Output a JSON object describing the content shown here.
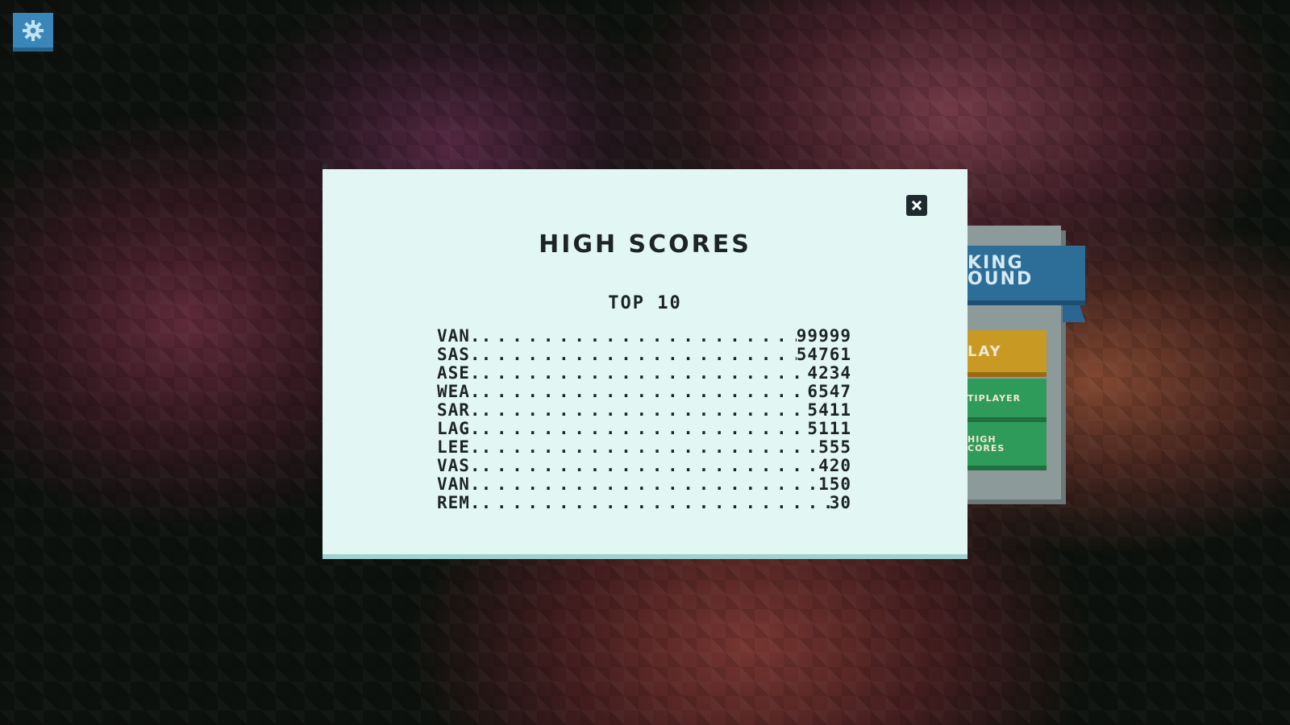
{
  "colors": {
    "dialog_bg": "#e2f7f4",
    "text": "#1e2426",
    "settings_button": "#3a86b8",
    "play_button": "#c99a23",
    "green_button": "#2f9b5a",
    "logo_blue": "#2d6e99"
  },
  "settings": {
    "icon": "gear-icon"
  },
  "main_menu": {
    "logo_line1": "KING",
    "logo_line2": "OUND",
    "play_label": "LAY",
    "multiplayer_label": "TIPLAYER",
    "high_scores_line1": "HIGH",
    "high_scores_line2": "CORES"
  },
  "dialog": {
    "title": "HIGH SCORES",
    "subtitle": "TOP 10",
    "close_icon": "close-icon",
    "scores": [
      {
        "name": "VAN.",
        "score": "99999"
      },
      {
        "name": "SAS.",
        "score": "54761"
      },
      {
        "name": "ASE.",
        "score": "4234"
      },
      {
        "name": "WEA.",
        "score": "6547"
      },
      {
        "name": "SAR.",
        "score": "5411"
      },
      {
        "name": "LAG.",
        "score": "5111"
      },
      {
        "name": "LEE.",
        "score": "555"
      },
      {
        "name": "VAS.",
        "score": "420"
      },
      {
        "name": "VAN.",
        "score": "150"
      },
      {
        "name": "REM.",
        "score": "30"
      }
    ]
  }
}
